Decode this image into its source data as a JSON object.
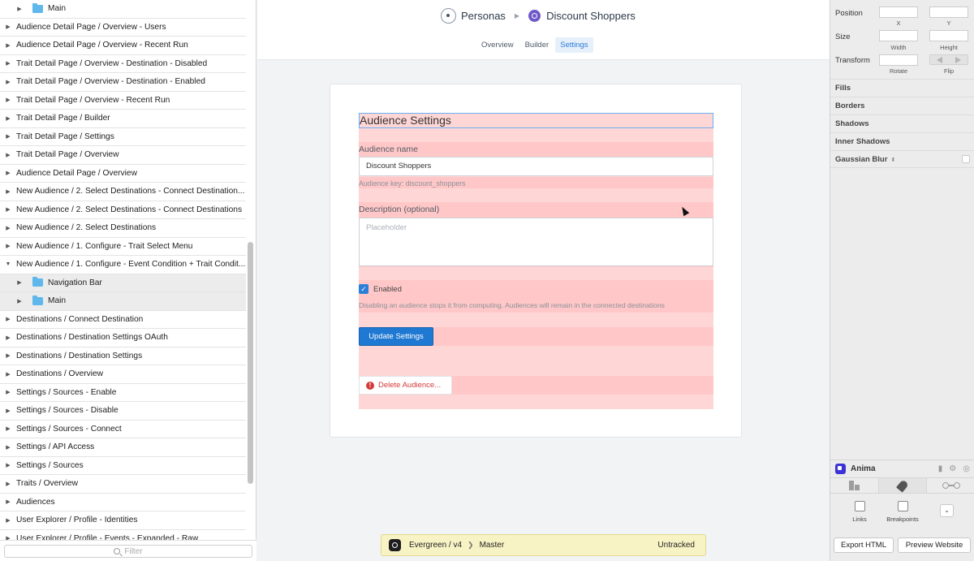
{
  "layers": [
    {
      "label": "Main",
      "sub": true,
      "folder": true
    },
    {
      "label": "Audience Detail Page / Overview - Users"
    },
    {
      "label": "Audience Detail Page / Overview - Recent Run"
    },
    {
      "label": "Trait Detail Page / Overview - Destination - Disabled"
    },
    {
      "label": "Trait Detail Page / Overview - Destination - Enabled"
    },
    {
      "label": "Trait Detail Page / Overview - Recent Run"
    },
    {
      "label": "Trait Detail Page / Builder"
    },
    {
      "label": "Trait Detail Page / Settings"
    },
    {
      "label": "Trait Detail Page / Overview"
    },
    {
      "label": "Audience Detail Page / Overview"
    },
    {
      "label": "New Audience / 2. Select Destinations - Connect Destination..."
    },
    {
      "label": "New Audience / 2. Select Destinations - Connect Destinations"
    },
    {
      "label": "New Audience / 2. Select Destinations"
    },
    {
      "label": "New Audience / 1. Configure - Trait Select Menu"
    },
    {
      "label": "New Audience / 1. Configure -  Event Condition + Trait Condit...",
      "expanded": true
    },
    {
      "label": "Navigation Bar",
      "sub": true,
      "folder": true
    },
    {
      "label": "Main",
      "sub": true,
      "folder": true
    },
    {
      "label": "Destinations / Connect Destination"
    },
    {
      "label": "Destinations / Destination Settings OAuth"
    },
    {
      "label": "Destinations / Destination Settings"
    },
    {
      "label": "Destinations / Overview"
    },
    {
      "label": "Settings / Sources - Enable"
    },
    {
      "label": "Settings / Sources - Disable"
    },
    {
      "label": "Settings / Sources - Connect"
    },
    {
      "label": "Settings / API Access"
    },
    {
      "label": "Settings / Sources"
    },
    {
      "label": "Traits / Overview"
    },
    {
      "label": "Audiences"
    },
    {
      "label": "User Explorer / Profile - Identities"
    },
    {
      "label": "User Explorer / Profile - Events - Expanded - Raw"
    }
  ],
  "filter": {
    "placeholder": "Filter"
  },
  "header": {
    "app_name": "Personas",
    "audience_name": "Discount Shoppers",
    "tabs": [
      {
        "label": "Overview",
        "active": false
      },
      {
        "label": "Builder",
        "active": false
      },
      {
        "label": "Settings",
        "active": true
      }
    ]
  },
  "settings_form": {
    "title": "Audience Settings",
    "name_label": "Audience name",
    "name_value": "Discount Shoppers",
    "key_hint": "Audience key: discount_shoppers",
    "description_label": "Description (optional)",
    "description_placeholder": "Placeholder",
    "enabled_label": "Enabled",
    "enabled_checked": true,
    "enabled_hint": "Disabling an audience stops it from computing. Audiences will remain in the connected destinations",
    "update_button": "Update Settings",
    "delete_button": "Delete Audience..."
  },
  "version_control": {
    "project": "Evergreen / v4",
    "branch": "Master",
    "status": "Untracked"
  },
  "inspector": {
    "position_label": "Position",
    "x_label": "X",
    "y_label": "Y",
    "size_label": "Size",
    "width_label": "Width",
    "height_label": "Height",
    "transform_label": "Transform",
    "rotate_label": "Rotate",
    "flip_label": "Flip",
    "sections": [
      "Fills",
      "Borders",
      "Shadows",
      "Inner Shadows",
      "Gaussian Blur"
    ]
  },
  "anima": {
    "title": "Anima",
    "links_label": "Links",
    "breakpoints_label": "Breakpoints",
    "export_button": "Export HTML",
    "preview_button": "Preview Website"
  },
  "colors": {
    "accent_blue": "#1f78d1",
    "danger_red": "#d43a3a",
    "overlay_pink": "#ffd6d6",
    "folder_blue": "#5fb7ec",
    "anima_purple": "#3b33d6"
  }
}
